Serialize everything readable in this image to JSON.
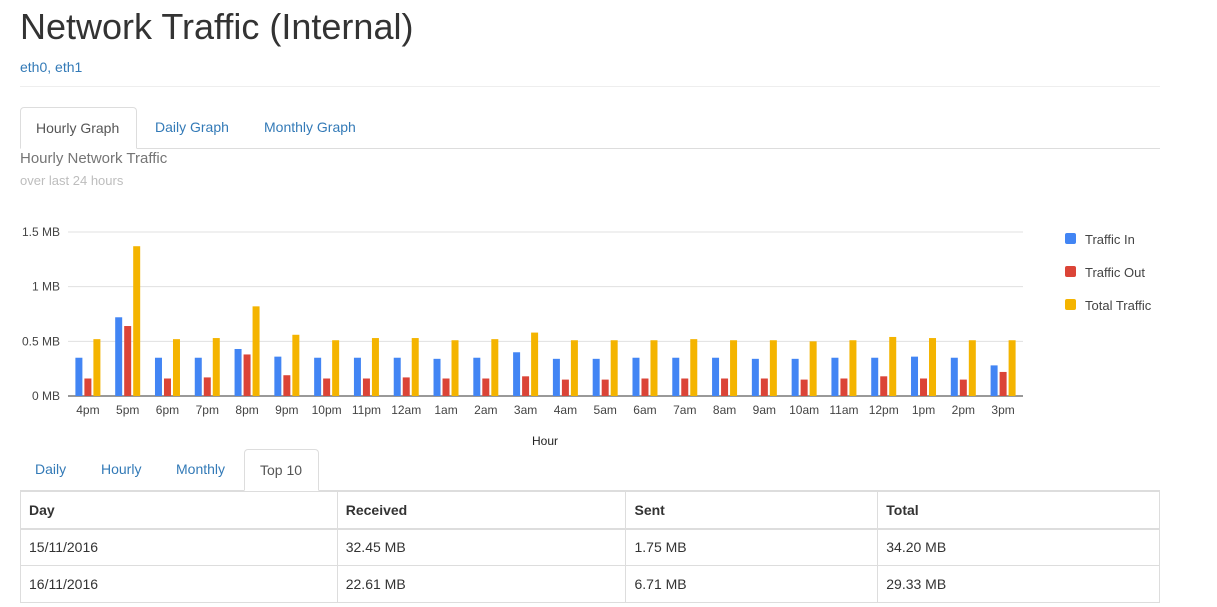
{
  "page": {
    "title": "Network Traffic (Internal)",
    "interfaces": "eth0, eth1"
  },
  "graph_tabs": [
    {
      "label": "Hourly Graph",
      "active": true
    },
    {
      "label": "Daily Graph",
      "active": false
    },
    {
      "label": "Monthly Graph",
      "active": false
    }
  ],
  "chart_header": {
    "title": "Hourly Network Traffic",
    "subtitle": "over last 24 hours"
  },
  "colors": {
    "traffic_in": "#4285f4",
    "traffic_out": "#db4437",
    "total": "#f4b400",
    "grid": "#e0e0e0",
    "axis_text": "#444444"
  },
  "chart_data": {
    "type": "bar",
    "title": "",
    "xlabel": "Hour",
    "ylabel": "",
    "ylim": [
      0,
      1.5
    ],
    "y_ticks": [
      0,
      0.5,
      1,
      1.5
    ],
    "y_tick_labels": [
      "0 MB",
      "0.5 MB",
      "1 MB",
      "1.5 MB"
    ],
    "grid": true,
    "legend_position": "right",
    "categories": [
      "4pm",
      "5pm",
      "6pm",
      "7pm",
      "8pm",
      "9pm",
      "10pm",
      "11pm",
      "12am",
      "1am",
      "2am",
      "3am",
      "4am",
      "5am",
      "6am",
      "7am",
      "8am",
      "9am",
      "10am",
      "11am",
      "12pm",
      "1pm",
      "2pm",
      "3pm"
    ],
    "series": [
      {
        "name": "Traffic In",
        "values": [
          0.35,
          0.72,
          0.35,
          0.35,
          0.43,
          0.36,
          0.35,
          0.35,
          0.35,
          0.34,
          0.35,
          0.4,
          0.34,
          0.34,
          0.35,
          0.35,
          0.35,
          0.34,
          0.34,
          0.35,
          0.35,
          0.36,
          0.35,
          0.28
        ]
      },
      {
        "name": "Traffic Out",
        "values": [
          0.16,
          0.64,
          0.16,
          0.17,
          0.38,
          0.19,
          0.16,
          0.16,
          0.17,
          0.16,
          0.16,
          0.18,
          0.15,
          0.15,
          0.16,
          0.16,
          0.16,
          0.16,
          0.15,
          0.16,
          0.18,
          0.16,
          0.15,
          0.22
        ]
      },
      {
        "name": "Total Traffic",
        "values": [
          0.52,
          1.37,
          0.52,
          0.53,
          0.82,
          0.56,
          0.51,
          0.53,
          0.53,
          0.51,
          0.52,
          0.58,
          0.51,
          0.51,
          0.51,
          0.52,
          0.51,
          0.51,
          0.5,
          0.51,
          0.54,
          0.53,
          0.51,
          0.51
        ]
      }
    ]
  },
  "table_tabs": [
    {
      "label": "Daily",
      "active": false
    },
    {
      "label": "Hourly",
      "active": false
    },
    {
      "label": "Monthly",
      "active": false
    },
    {
      "label": "Top 10",
      "active": true
    }
  ],
  "table": {
    "headers": [
      "Day",
      "Received",
      "Sent",
      "Total"
    ],
    "rows": [
      [
        "15/11/2016",
        "32.45 MB",
        "1.75 MB",
        "34.20 MB"
      ],
      [
        "16/11/2016",
        "22.61 MB",
        "6.71 MB",
        "29.33 MB"
      ]
    ]
  }
}
